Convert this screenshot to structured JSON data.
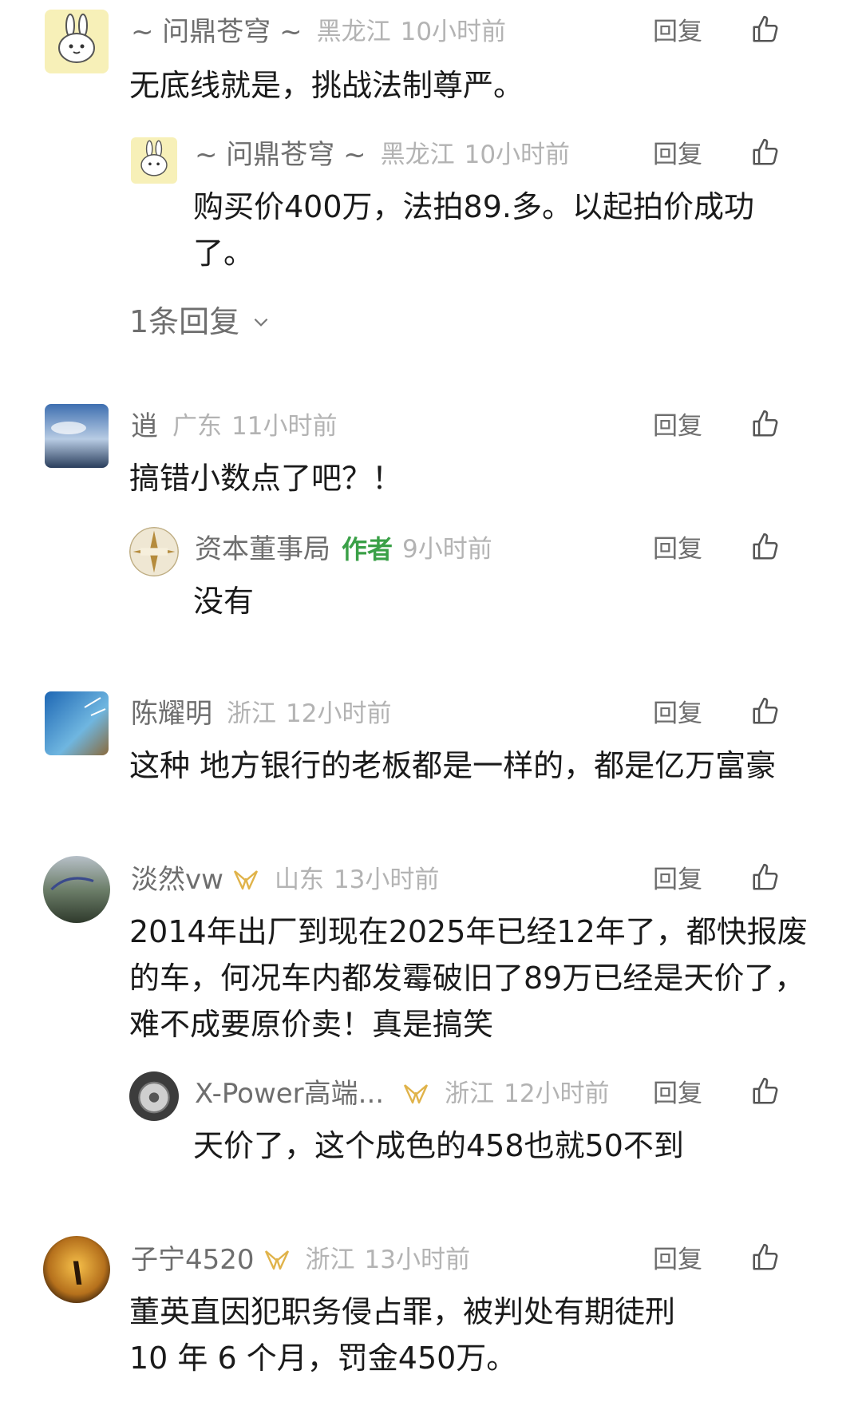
{
  "ui": {
    "reply_label": "回复",
    "like_icon": "thumbs-up-icon"
  },
  "comments": [
    {
      "user": "~ 问鼎苍穹 ~",
      "location": "黑龙江",
      "time": "10小时前",
      "text": "无底线就是，挑战法制尊严。",
      "reply": {
        "user": "~ 问鼎苍穹 ~",
        "location": "黑龙江",
        "time": "10小时前",
        "text": "购买价400万，法拍89.多。以起拍价成功了。"
      },
      "more_replies": "1条回复"
    },
    {
      "user": "逍",
      "location": "广东",
      "time": "11小时前",
      "text": "搞错小数点了吧？！",
      "reply": {
        "user": "资本董事局",
        "author_tag": "作者",
        "time": "9小时前",
        "text": "没有"
      }
    },
    {
      "user": "陈耀明",
      "location": "浙江",
      "time": "12小时前",
      "text": "这种 地方银行的老板都是一样的，都是亿万富豪"
    },
    {
      "user": "淡然vw",
      "location": "山东",
      "time": "13小时前",
      "text": "2014年出厂到现在2025年已经12年了，都快报废的车，何况车内都发霉破旧了89万已经是天价了，难不成要原价卖！真是搞笑",
      "reply": {
        "user": "X-Power高端...",
        "location": "浙江",
        "time": "12小时前",
        "text": "天价了，这个成色的458也就50不到"
      }
    },
    {
      "user": "子宁4520",
      "location": "浙江",
      "time": "13小时前",
      "text": "董英直因犯职务侵占罪，被判处有期徒刑 10 年 6 个月，罚金450万。"
    }
  ]
}
